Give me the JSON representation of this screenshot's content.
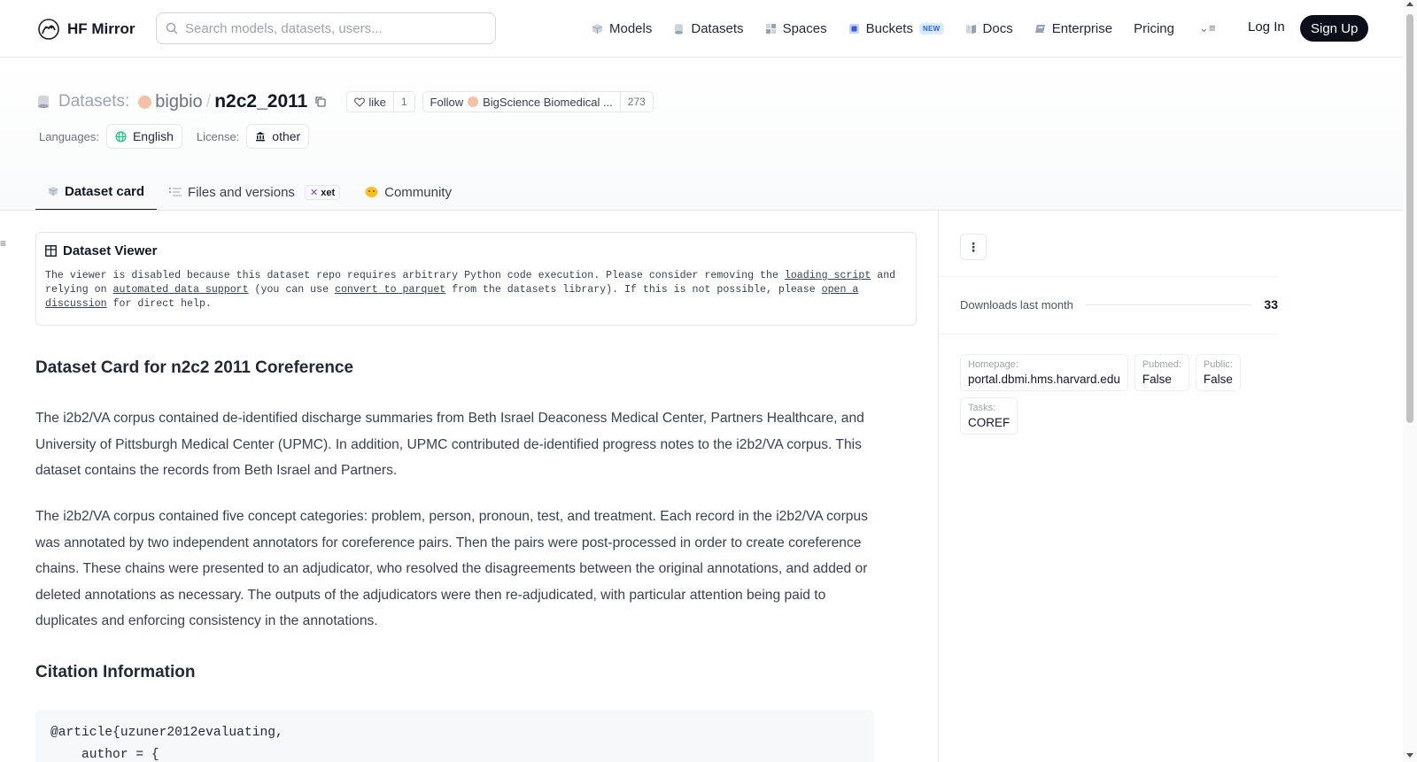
{
  "brand": {
    "name": "HF Mirror",
    "logo_icon": "hf-mirror-logo-icon"
  },
  "search": {
    "placeholder": "Search models, datasets, users..."
  },
  "nav": {
    "items": [
      {
        "label": "Models",
        "icon": "cube-icon",
        "color": "#9ca3af"
      },
      {
        "label": "Datasets",
        "icon": "database-icon",
        "color": "#9ca3af"
      },
      {
        "label": "Spaces",
        "icon": "grid-icon",
        "color": "#9ca3af"
      },
      {
        "label": "Buckets",
        "icon": "bucket-icon",
        "color": "#3b5bdb",
        "badge": "NEW"
      },
      {
        "label": "Docs",
        "icon": "book-icon",
        "color": "#9ca3af"
      },
      {
        "label": "Enterprise",
        "icon": "briefcase-icon",
        "color": "#9ca3af"
      },
      {
        "label": "Pricing"
      }
    ],
    "more_label": "⌄≡",
    "login": "Log In",
    "signup": "Sign Up"
  },
  "repo": {
    "prefix": "Datasets:",
    "org": "bigbio",
    "separator": "/",
    "name": "n2c2_2011",
    "like_label": "like",
    "like_count": "1",
    "follow_label": "Follow",
    "follow_org": "BigScience Biomedical ...",
    "follow_count": "273"
  },
  "meta": {
    "languages_label": "Languages:",
    "language": "English",
    "license_label": "License:",
    "license": "other"
  },
  "tabs": [
    {
      "label": "Dataset card",
      "icon": "cube-icon",
      "active": true
    },
    {
      "label": "Files and versions",
      "icon": "files-icon",
      "badge": "xet"
    },
    {
      "label": "Community",
      "icon": "community-icon"
    }
  ],
  "viewer": {
    "title": "Dataset Viewer",
    "text_1": "The viewer is disabled because this dataset repo requires arbitrary Python code execution. Please consider removing the ",
    "link_1": "loading script",
    "text_2": " and relying on ",
    "link_2": "automated data support",
    "text_3": " (you can use ",
    "link_3": "convert to parquet",
    "text_4": " from the datasets library). If this is not possible, please ",
    "link_4": "open a discussion",
    "text_5": " for direct help."
  },
  "card": {
    "heading": "Dataset Card for n2c2 2011 Coreference",
    "paragraph_1": "The i2b2/VA corpus contained de-identified discharge summaries from Beth Israel Deaconess Medical Center, Partners Healthcare, and University of Pittsburgh Medical Center (UPMC). In addition, UPMC contributed de-identified progress notes to the i2b2/VA corpus. This dataset contains the records from Beth Israel and Partners.",
    "paragraph_2": "The i2b2/VA corpus contained five concept categories: problem, person, pronoun, test, and treatment. Each record in the i2b2/VA corpus was annotated by two independent annotators for coreference pairs. Then the pairs were post-processed in order to create coreference chains. These chains were presented to an adjudicator, who resolved the disagreements between the original annotations, and added or deleted annotations as necessary. The outputs of the adjudicators were then re-adjudicated, with particular attention being paid to duplicates and enforcing consistency in the annotations.",
    "citation_heading": "Citation Information",
    "citation_code": "@article{uzuner2012evaluating,\n    author = {"
  },
  "sidebar": {
    "downloads_label": "Downloads last month",
    "downloads_value": "33",
    "cards": [
      {
        "key": "Homepage:",
        "value": "portal.dbmi.hms.harvard.edu"
      },
      {
        "key": "Pubmed:",
        "value": "False"
      },
      {
        "key": "Public:",
        "value": "False"
      },
      {
        "key": "Tasks:",
        "value": "COREF"
      }
    ]
  }
}
